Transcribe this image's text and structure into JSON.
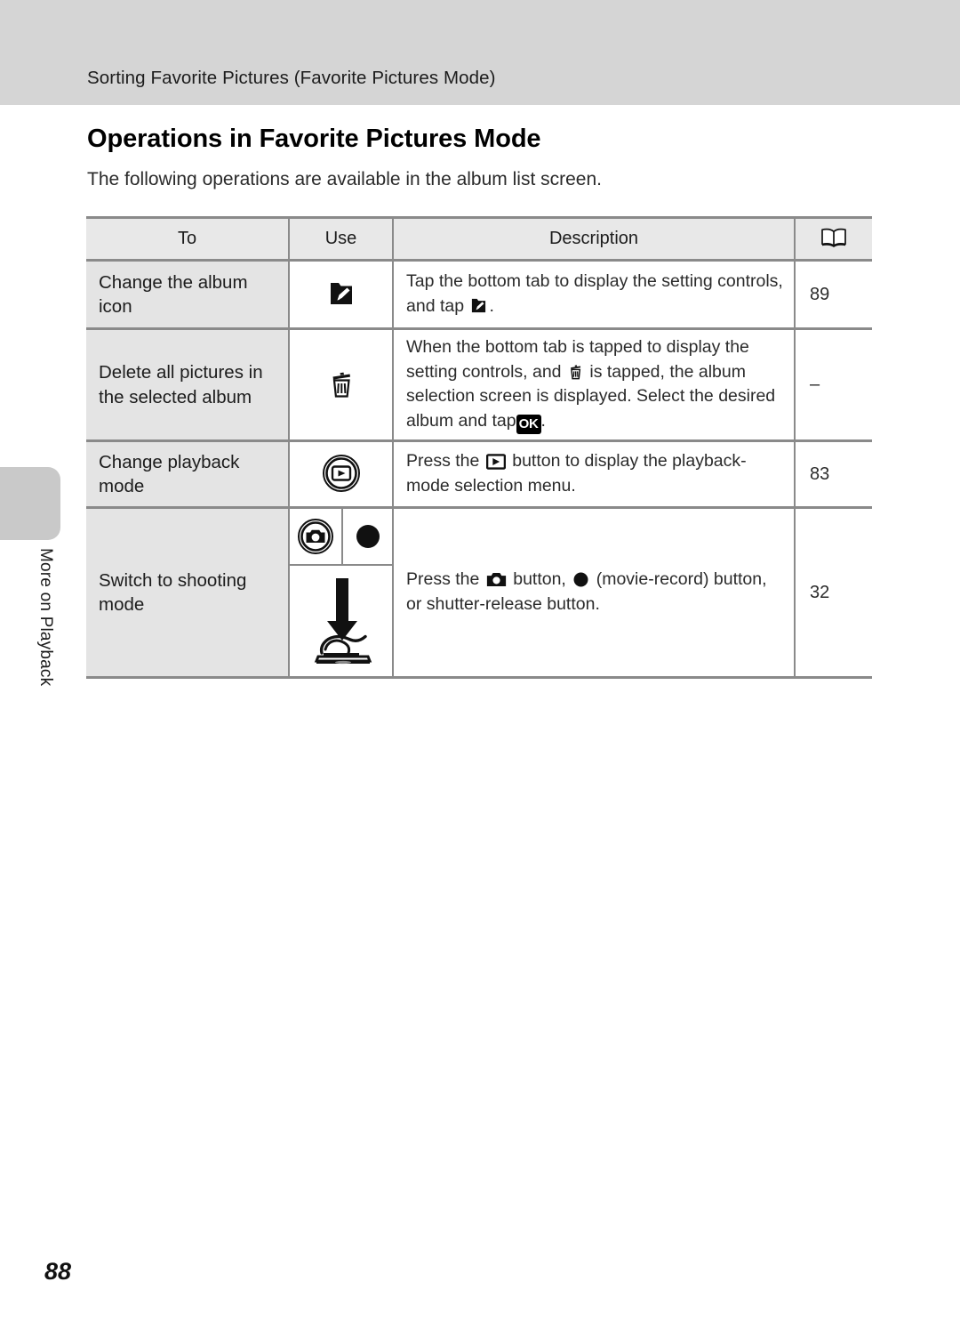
{
  "running_head": "Sorting Favorite Pictures (Favorite Pictures Mode)",
  "page_title": "Operations in Favorite Pictures Mode",
  "intro": "The following operations are available in the album list screen.",
  "margin_tab": {
    "label": "More on Playback"
  },
  "folio": "88",
  "table": {
    "headers": {
      "to": "To",
      "use": "Use",
      "description": "Description",
      "reference_icon": "open-book-icon"
    },
    "rows": [
      {
        "to": "Change the album icon",
        "use_icons": [
          "album-edit-icon"
        ],
        "description_parts": [
          {
            "type": "text",
            "value": "Tap the bottom tab to display the setting controls, and tap "
          },
          {
            "type": "icon",
            "value": "album-edit-icon"
          },
          {
            "type": "text",
            "value": "."
          }
        ],
        "description_text": "Tap the bottom tab to display the setting controls, and tap [album-edit-icon].",
        "reference": "89"
      },
      {
        "to": "Delete all pictures in the selected album",
        "use_icons": [
          "trash-icon"
        ],
        "description_parts": [
          {
            "type": "text",
            "value": "When the bottom tab is tapped to display the setting controls, and "
          },
          {
            "type": "icon",
            "value": "trash-icon"
          },
          {
            "type": "text",
            "value": " is tapped, the album selection screen is displayed. Select the desired album and tap "
          },
          {
            "type": "badge",
            "value": "OK"
          },
          {
            "type": "text",
            "value": "."
          }
        ],
        "description_text": "When the bottom tab is tapped to display the setting controls, and [trash-icon] is tapped, the album selection screen is displayed. Select the desired album and tap OK.",
        "reference": "–"
      },
      {
        "to": "Change playback mode",
        "use_icons": [
          "playback-button-icon"
        ],
        "description_parts": [
          {
            "type": "text",
            "value": "Press the "
          },
          {
            "type": "icon",
            "value": "playback-glyph-icon"
          },
          {
            "type": "text",
            "value": " button to display the playback-mode selection menu."
          }
        ],
        "description_text": "Press the [playback-icon] button to display the playback-mode selection menu.",
        "reference": "83"
      },
      {
        "to": "Switch to shooting mode",
        "use_icons": [
          "camera-button-icon",
          "movie-record-icon",
          "shutter-press-icon"
        ],
        "description_parts": [
          {
            "type": "text",
            "value": "Press the "
          },
          {
            "type": "icon",
            "value": "camera-glyph-icon"
          },
          {
            "type": "text",
            "value": " button, "
          },
          {
            "type": "icon",
            "value": "movie-record-icon"
          },
          {
            "type": "text",
            "value": " (movie-record) button, or shutter-release button."
          }
        ],
        "description_text": "Press the [camera-icon] button, [movie-record-icon] (movie-record) button, or shutter-release button.",
        "reference": "32"
      }
    ]
  },
  "colors": {
    "band": "#d5d5d5",
    "header_cell": "#e8e8e8",
    "first_column": "#e4e4e4",
    "rule": "#8a8a8a",
    "tab": "#c9c9c9"
  }
}
